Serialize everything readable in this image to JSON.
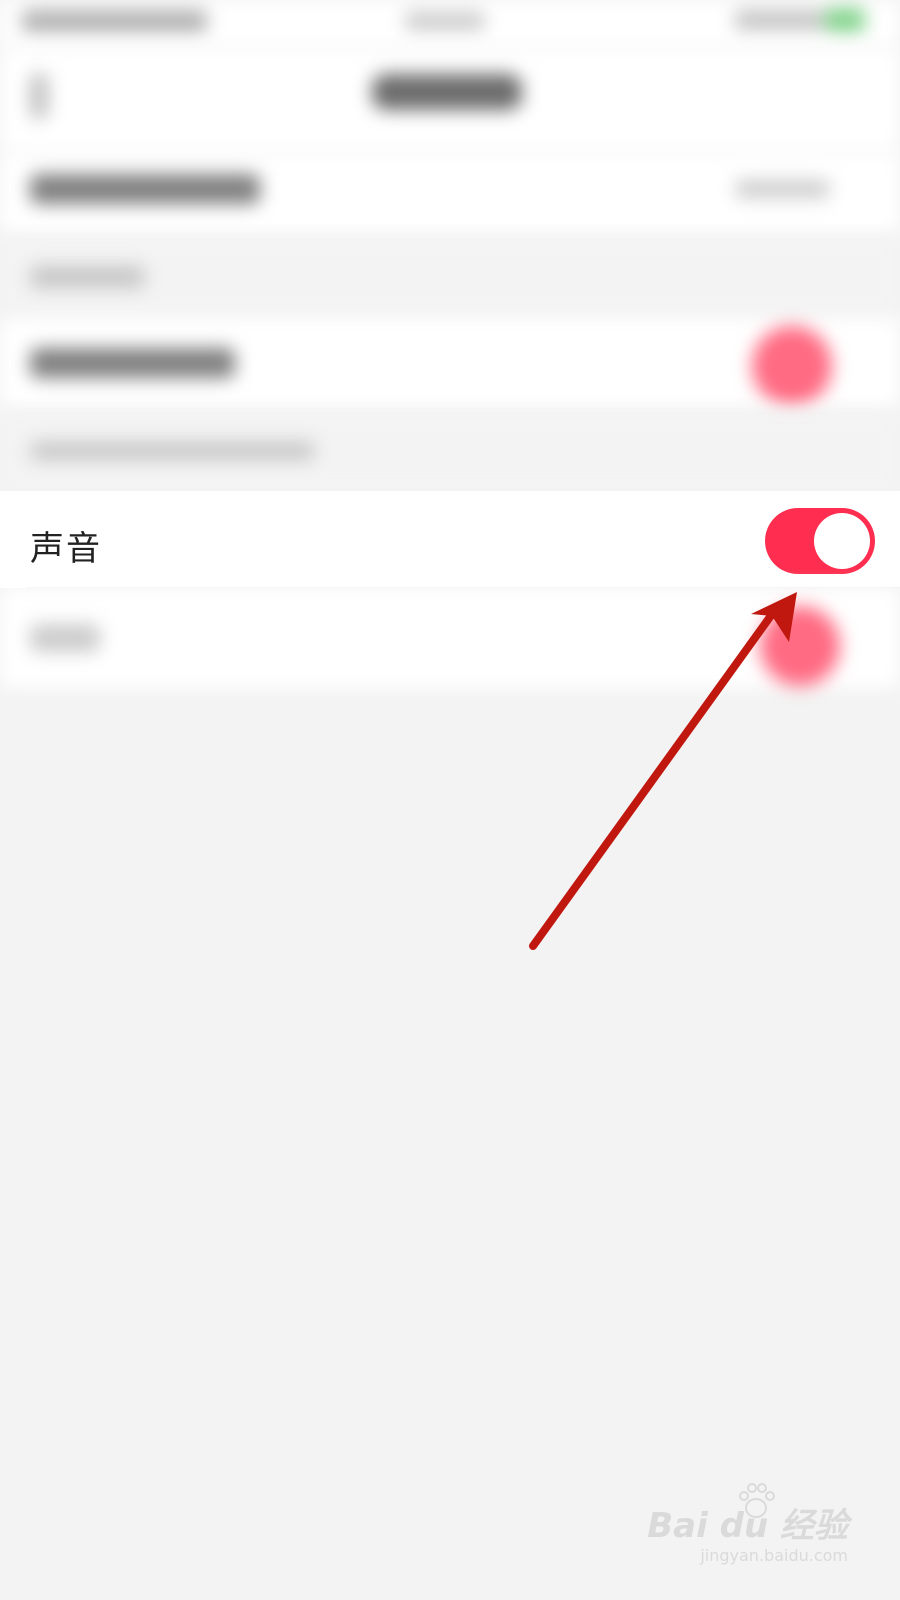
{
  "settings": {
    "sound_label": "声音",
    "sound_enabled": true
  },
  "colors": {
    "toggle_on": "#ff2d4f",
    "annotation_arrow": "#c0170f",
    "page_background": "#f3f3f3"
  },
  "watermark": {
    "logo": "Bai du 经验",
    "url": "jingyan.baidu.com"
  }
}
